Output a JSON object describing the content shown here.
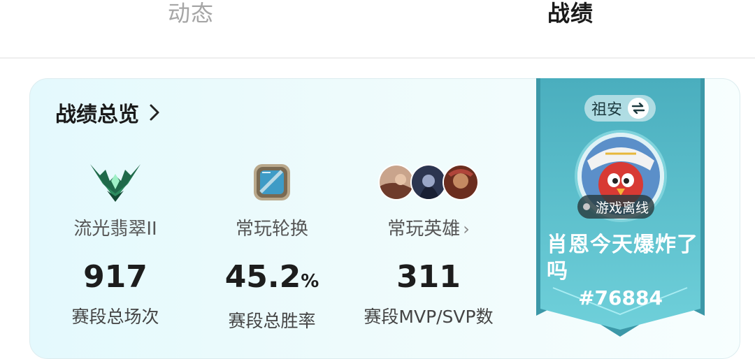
{
  "tabs": [
    {
      "label": "动态",
      "active": false
    },
    {
      "label": "战绩",
      "active": true
    }
  ],
  "overview": {
    "title": "战绩总览",
    "columns": [
      {
        "icon": "rank-emblem-icon",
        "label": "流光翡翠II",
        "value": "917",
        "unit": "",
        "sub": "赛段总场次"
      },
      {
        "icon": "rotation-mode-icon",
        "label": "常玩轮换",
        "value": "45.2",
        "unit": "%",
        "sub": "赛段总胜率"
      },
      {
        "icon": "hero-avatars-icon",
        "label": "常玩英雄",
        "value": "311",
        "unit": "",
        "sub": "赛段MVP/SVP数"
      }
    ]
  },
  "profile": {
    "region": "祖安",
    "status": "游戏离线",
    "name": "肖恩今天爆炸了吗",
    "id": "#76884"
  },
  "colors": {
    "banner": "#4fb8c7",
    "card_bg": "#e4f9fd",
    "active_tab": "#1a1a1a",
    "inactive_tab": "#a6a6a6"
  }
}
